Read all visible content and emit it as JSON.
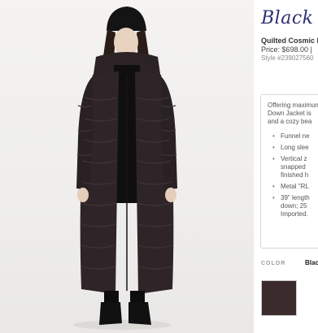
{
  "product": {
    "brand_title": "Black Label",
    "name": "Quilted Cosmic Down Jacket",
    "price": "Price: $698.00 |",
    "style": "Style #239027560"
  },
  "description": {
    "intro_lines": [
      "Offering maximum warmth",
      "Down Jacket is",
      "and a cozy bea"
    ],
    "bullets": [
      {
        "lines": [
          "Funnel ne"
        ]
      },
      {
        "lines": [
          "Long slee"
        ]
      },
      {
        "lines": [
          "Vertical z",
          "snapped",
          "finished h"
        ]
      },
      {
        "lines": [
          "Metal \"RL"
        ]
      },
      {
        "lines": [
          "39\" length",
          "down; 25",
          "Imported."
        ]
      }
    ]
  },
  "color": {
    "label": "COLOR",
    "selected": "Black",
    "swatch_hex": "#3b2b2c"
  },
  "photo": {
    "alt_icon": "product-photo",
    "background": "#efeeec"
  }
}
